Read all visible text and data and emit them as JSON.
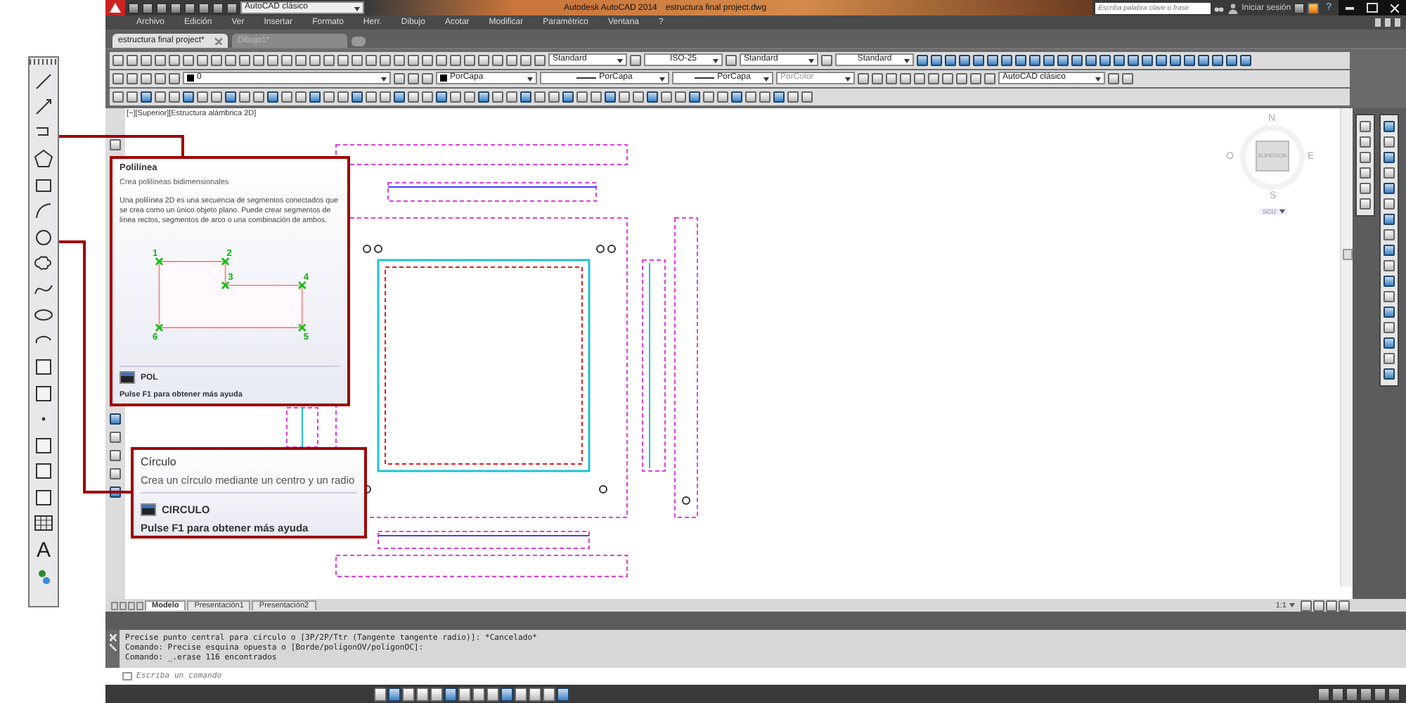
{
  "title_bar": {
    "workspace": "AutoCAD clásico",
    "title": "Autodesk AutoCAD 2014",
    "file": "estructura final project.dwg",
    "search": {
      "placeholder": "Escriba palabra clave o frase"
    },
    "sign_in": "Iniciar sesión",
    "help": "?"
  },
  "menu": [
    "Archivo",
    "Edición",
    "Ver",
    "Insertar",
    "Formato",
    "Herr.",
    "Dibujo",
    "Acotar",
    "Modificar",
    "Paramétrico",
    "Ventana",
    "?"
  ],
  "file_tabs": [
    {
      "label": "estructura final project*",
      "selected": true
    },
    {
      "label": "Dibujo1*",
      "selected": false
    }
  ],
  "toolbars": {
    "text_style": "Standard",
    "dim_style": "ISO-25",
    "table_style": "Standard",
    "multileader_style": "Standard",
    "layer": "0",
    "color_control": "PorCapa",
    "linetype": "PorCapa",
    "lineweight": "PorCapa",
    "plot_style": {
      "label": "PorColor",
      "disabled": true
    },
    "workspace": "AutoCAD clásico"
  },
  "viewport_label": "[−][Superior][Estructura alámbrica 2D]",
  "viewcube": {
    "north": "N",
    "south": "S",
    "east": "E",
    "west": "O",
    "face": "SUPERIOR",
    "ucs": "SCU"
  },
  "left_toolbar": {
    "text_tool": "A"
  },
  "tooltips": [
    {
      "kind": "extended",
      "title": "Polilínea",
      "summary": "Crea polilíneas bidimensionales",
      "description": "Una polilínea 2D es una secuencia de segmentos conectados que se crea como un único objeto plano. Puede crear segmentos de línea rectos, segmentos de arco o una combinación de ambos.",
      "points": [
        "1",
        "2",
        "3",
        "4",
        "5",
        "6"
      ],
      "command": "POL",
      "help": "Pulse F1 para obtener más ayuda"
    },
    {
      "kind": "basic",
      "title": "Círculo",
      "summary": "Crea un círculo mediante un centro y un radio",
      "command": "CIRCULO",
      "help": "Pulse F1 para obtener más ayuda"
    }
  ],
  "layout_tabs": [
    {
      "label": "Modelo",
      "selected": true
    },
    {
      "label": "Presentación1",
      "selected": false
    },
    {
      "label": "Presentación2",
      "selected": false
    }
  ],
  "annotation_scale": "1:1",
  "command_history": [
    "Precise punto central para círculo o [3P/2P/Ttr (Tangente tangente radio)]: *Cancelado*",
    "Comando: Precise esquina opuesta o [Borde/polígonOV/polígonOC]:",
    "Comando:  _.erase 116 encontrados"
  ],
  "command_input": {
    "placeholder": "Escriba un comando"
  }
}
